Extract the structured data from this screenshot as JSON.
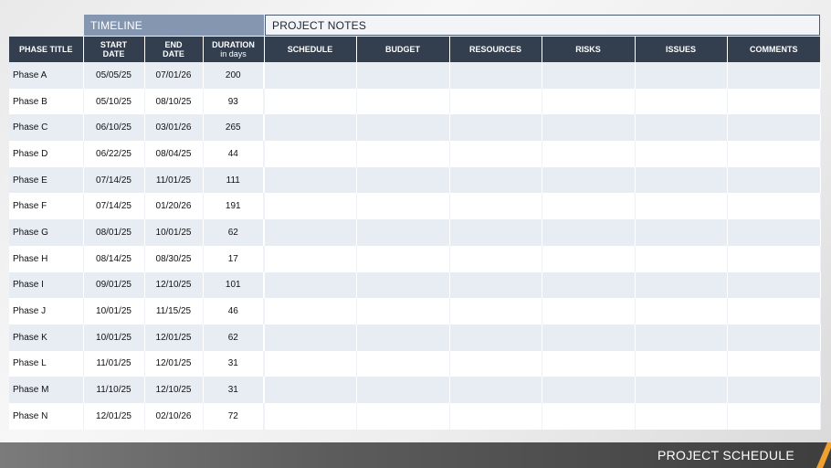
{
  "labels": {
    "timeline": "TIMELINE",
    "notes": "PROJECT NOTES"
  },
  "headers": {
    "phase_title": "PHASE TITLE",
    "start": [
      "START",
      "DATE"
    ],
    "end": [
      "END",
      "DATE"
    ],
    "duration": "DURATION",
    "duration_sub": "in days",
    "schedule": "SCHEDULE",
    "budget": "BUDGET",
    "resources": "RESOURCES",
    "risks": "RISKS",
    "issues": "ISSUES",
    "comments": "COMMENTS"
  },
  "rows": [
    {
      "phase": "Phase A",
      "start": "05/05/25",
      "end": "07/01/26",
      "duration": "200"
    },
    {
      "phase": "Phase B",
      "start": "05/10/25",
      "end": "08/10/25",
      "duration": "93"
    },
    {
      "phase": "Phase C",
      "start": "06/10/25",
      "end": "03/01/26",
      "duration": "265"
    },
    {
      "phase": "Phase D",
      "start": "06/22/25",
      "end": "08/04/25",
      "duration": "44"
    },
    {
      "phase": "Phase E",
      "start": "07/14/25",
      "end": "11/01/25",
      "duration": "111"
    },
    {
      "phase": "Phase F",
      "start": "07/14/25",
      "end": "01/20/26",
      "duration": "191"
    },
    {
      "phase": "Phase G",
      "start": "08/01/25",
      "end": "10/01/25",
      "duration": "62"
    },
    {
      "phase": "Phase H",
      "start": "08/14/25",
      "end": "08/30/25",
      "duration": "17"
    },
    {
      "phase": "Phase I",
      "start": "09/01/25",
      "end": "12/10/25",
      "duration": "101"
    },
    {
      "phase": "Phase J",
      "start": "10/01/25",
      "end": "11/15/25",
      "duration": "46"
    },
    {
      "phase": "Phase K",
      "start": "10/01/25",
      "end": "12/01/25",
      "duration": "62"
    },
    {
      "phase": "Phase L",
      "start": "11/01/25",
      "end": "12/01/25",
      "duration": "31"
    },
    {
      "phase": "Phase M",
      "start": "11/10/25",
      "end": "12/10/25",
      "duration": "31"
    },
    {
      "phase": "Phase N",
      "start": "12/01/25",
      "end": "02/10/26",
      "duration": "72"
    }
  ],
  "footer": {
    "title": "PROJECT SCHEDULE"
  },
  "colors": {
    "header_bg": "#333f4f",
    "timeline_bg": "#8597b0",
    "row_alt": "#e8edf4",
    "accent": "#f0a030"
  }
}
